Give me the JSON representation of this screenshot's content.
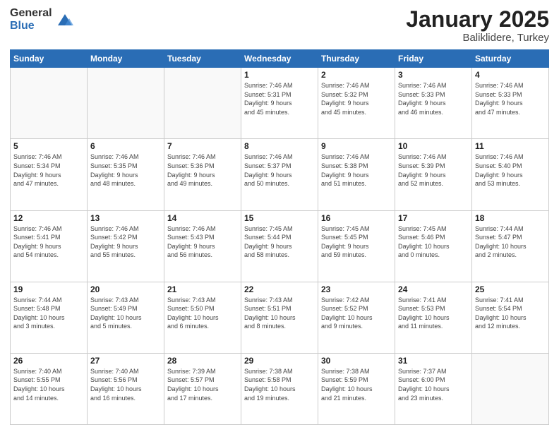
{
  "logo": {
    "general": "General",
    "blue": "Blue"
  },
  "title": {
    "month": "January 2025",
    "location": "Baliklidere, Turkey"
  },
  "weekdays": [
    "Sunday",
    "Monday",
    "Tuesday",
    "Wednesday",
    "Thursday",
    "Friday",
    "Saturday"
  ],
  "weeks": [
    [
      {
        "day": "",
        "info": ""
      },
      {
        "day": "",
        "info": ""
      },
      {
        "day": "",
        "info": ""
      },
      {
        "day": "1",
        "info": "Sunrise: 7:46 AM\nSunset: 5:31 PM\nDaylight: 9 hours\nand 45 minutes."
      },
      {
        "day": "2",
        "info": "Sunrise: 7:46 AM\nSunset: 5:32 PM\nDaylight: 9 hours\nand 45 minutes."
      },
      {
        "day": "3",
        "info": "Sunrise: 7:46 AM\nSunset: 5:33 PM\nDaylight: 9 hours\nand 46 minutes."
      },
      {
        "day": "4",
        "info": "Sunrise: 7:46 AM\nSunset: 5:33 PM\nDaylight: 9 hours\nand 47 minutes."
      }
    ],
    [
      {
        "day": "5",
        "info": "Sunrise: 7:46 AM\nSunset: 5:34 PM\nDaylight: 9 hours\nand 47 minutes."
      },
      {
        "day": "6",
        "info": "Sunrise: 7:46 AM\nSunset: 5:35 PM\nDaylight: 9 hours\nand 48 minutes."
      },
      {
        "day": "7",
        "info": "Sunrise: 7:46 AM\nSunset: 5:36 PM\nDaylight: 9 hours\nand 49 minutes."
      },
      {
        "day": "8",
        "info": "Sunrise: 7:46 AM\nSunset: 5:37 PM\nDaylight: 9 hours\nand 50 minutes."
      },
      {
        "day": "9",
        "info": "Sunrise: 7:46 AM\nSunset: 5:38 PM\nDaylight: 9 hours\nand 51 minutes."
      },
      {
        "day": "10",
        "info": "Sunrise: 7:46 AM\nSunset: 5:39 PM\nDaylight: 9 hours\nand 52 minutes."
      },
      {
        "day": "11",
        "info": "Sunrise: 7:46 AM\nSunset: 5:40 PM\nDaylight: 9 hours\nand 53 minutes."
      }
    ],
    [
      {
        "day": "12",
        "info": "Sunrise: 7:46 AM\nSunset: 5:41 PM\nDaylight: 9 hours\nand 54 minutes."
      },
      {
        "day": "13",
        "info": "Sunrise: 7:46 AM\nSunset: 5:42 PM\nDaylight: 9 hours\nand 55 minutes."
      },
      {
        "day": "14",
        "info": "Sunrise: 7:46 AM\nSunset: 5:43 PM\nDaylight: 9 hours\nand 56 minutes."
      },
      {
        "day": "15",
        "info": "Sunrise: 7:45 AM\nSunset: 5:44 PM\nDaylight: 9 hours\nand 58 minutes."
      },
      {
        "day": "16",
        "info": "Sunrise: 7:45 AM\nSunset: 5:45 PM\nDaylight: 9 hours\nand 59 minutes."
      },
      {
        "day": "17",
        "info": "Sunrise: 7:45 AM\nSunset: 5:46 PM\nDaylight: 10 hours\nand 0 minutes."
      },
      {
        "day": "18",
        "info": "Sunrise: 7:44 AM\nSunset: 5:47 PM\nDaylight: 10 hours\nand 2 minutes."
      }
    ],
    [
      {
        "day": "19",
        "info": "Sunrise: 7:44 AM\nSunset: 5:48 PM\nDaylight: 10 hours\nand 3 minutes."
      },
      {
        "day": "20",
        "info": "Sunrise: 7:43 AM\nSunset: 5:49 PM\nDaylight: 10 hours\nand 5 minutes."
      },
      {
        "day": "21",
        "info": "Sunrise: 7:43 AM\nSunset: 5:50 PM\nDaylight: 10 hours\nand 6 minutes."
      },
      {
        "day": "22",
        "info": "Sunrise: 7:43 AM\nSunset: 5:51 PM\nDaylight: 10 hours\nand 8 minutes."
      },
      {
        "day": "23",
        "info": "Sunrise: 7:42 AM\nSunset: 5:52 PM\nDaylight: 10 hours\nand 9 minutes."
      },
      {
        "day": "24",
        "info": "Sunrise: 7:41 AM\nSunset: 5:53 PM\nDaylight: 10 hours\nand 11 minutes."
      },
      {
        "day": "25",
        "info": "Sunrise: 7:41 AM\nSunset: 5:54 PM\nDaylight: 10 hours\nand 12 minutes."
      }
    ],
    [
      {
        "day": "26",
        "info": "Sunrise: 7:40 AM\nSunset: 5:55 PM\nDaylight: 10 hours\nand 14 minutes."
      },
      {
        "day": "27",
        "info": "Sunrise: 7:40 AM\nSunset: 5:56 PM\nDaylight: 10 hours\nand 16 minutes."
      },
      {
        "day": "28",
        "info": "Sunrise: 7:39 AM\nSunset: 5:57 PM\nDaylight: 10 hours\nand 17 minutes."
      },
      {
        "day": "29",
        "info": "Sunrise: 7:38 AM\nSunset: 5:58 PM\nDaylight: 10 hours\nand 19 minutes."
      },
      {
        "day": "30",
        "info": "Sunrise: 7:38 AM\nSunset: 5:59 PM\nDaylight: 10 hours\nand 21 minutes."
      },
      {
        "day": "31",
        "info": "Sunrise: 7:37 AM\nSunset: 6:00 PM\nDaylight: 10 hours\nand 23 minutes."
      },
      {
        "day": "",
        "info": ""
      }
    ]
  ]
}
